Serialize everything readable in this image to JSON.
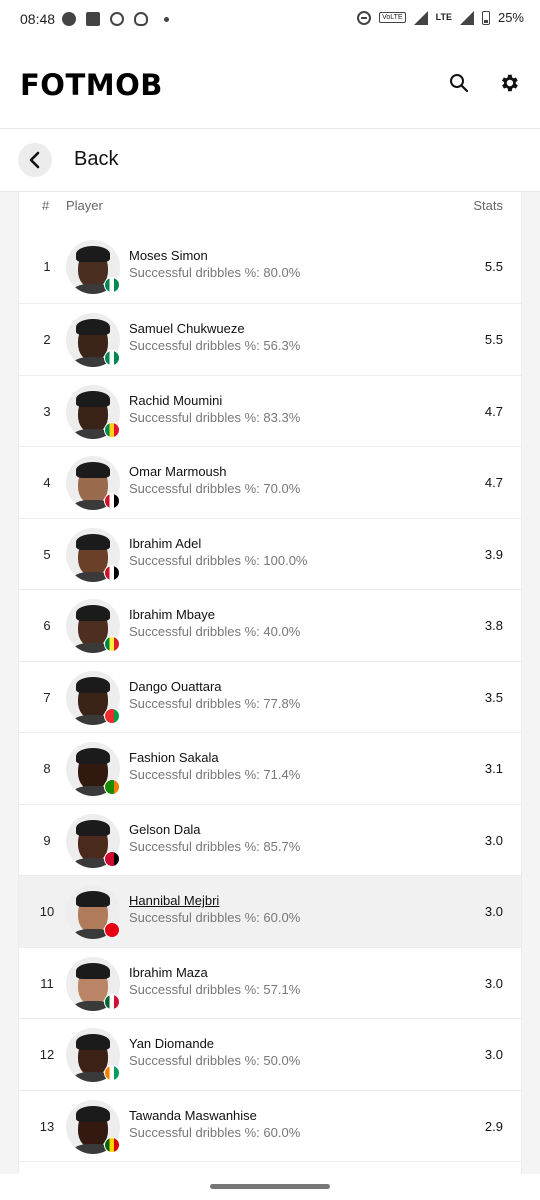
{
  "status_bar": {
    "time": "08:48",
    "battery": "25%",
    "volte": "VoLTE",
    "network": "LTE"
  },
  "app": {
    "logo_text": "FOTMOB"
  },
  "nav": {
    "back_label": "Back"
  },
  "table": {
    "headers": {
      "rank": "#",
      "player": "Player",
      "stats": "Stats"
    },
    "rows": [
      {
        "rank": "1",
        "name": "Moses Simon",
        "detail": "Successful dribbles %: 80.0%",
        "value": "5.5",
        "flag": [
          "#008751",
          "#ffffff",
          "#008751"
        ],
        "skin": "#4a2e1f"
      },
      {
        "rank": "2",
        "name": "Samuel Chukwueze",
        "detail": "Successful dribbles %: 56.3%",
        "value": "5.5",
        "flag": [
          "#008751",
          "#ffffff",
          "#008751"
        ],
        "skin": "#3d2418"
      },
      {
        "rank": "3",
        "name": "Rachid Moumini",
        "detail": "Successful dribbles %: 83.3%",
        "value": "4.7",
        "flag": [
          "#008751",
          "#fcd116",
          "#e8112d"
        ],
        "skin": "#3a2216"
      },
      {
        "rank": "4",
        "name": "Omar Marmoush",
        "detail": "Successful dribbles %: 70.0%",
        "value": "4.7",
        "flag": [
          "#ce1126",
          "#ffffff",
          "#000000"
        ],
        "skin": "#9a6a4c"
      },
      {
        "rank": "5",
        "name": "Ibrahim Adel",
        "detail": "Successful dribbles %: 100.0%",
        "value": "3.9",
        "flag": [
          "#ce1126",
          "#ffffff",
          "#000000"
        ],
        "skin": "#6b4028"
      },
      {
        "rank": "6",
        "name": "Ibrahim Mbaye",
        "detail": "Successful dribbles %: 40.0%",
        "value": "3.8",
        "flag": [
          "#00853f",
          "#fdef42",
          "#e31b23"
        ],
        "skin": "#4e2e1e"
      },
      {
        "rank": "7",
        "name": "Dango Ouattara",
        "detail": "Successful dribbles %: 77.8%",
        "value": "3.5",
        "flag": [
          "#ef2b2d",
          "#ef2b2d",
          "#009e49"
        ],
        "skin": "#3b2216"
      },
      {
        "rank": "8",
        "name": "Fashion Sakala",
        "detail": "Successful dribbles %: 71.4%",
        "value": "3.1",
        "flag": [
          "#198a00",
          "#198a00",
          "#ef7d00"
        ],
        "skin": "#32190f"
      },
      {
        "rank": "9",
        "name": "Gelson Dala",
        "detail": "Successful dribbles %: 85.7%",
        "value": "3.0",
        "flag": [
          "#cc092f",
          "#cc092f",
          "#000000"
        ],
        "skin": "#4a2a1a"
      },
      {
        "rank": "10",
        "name": "Hannibal Mejbri",
        "detail": "Successful dribbles %: 60.0%",
        "value": "3.0",
        "flag": [
          "#e70013",
          "#e70013",
          "#e70013"
        ],
        "skin": "#b07b5a"
      },
      {
        "rank": "11",
        "name": "Ibrahim Maza",
        "detail": "Successful dribbles %: 57.1%",
        "value": "3.0",
        "flag": [
          "#006233",
          "#ffffff",
          "#d21034"
        ],
        "skin": "#b98566"
      },
      {
        "rank": "12",
        "name": "Yan Diomande",
        "detail": "Successful dribbles %: 50.0%",
        "value": "3.0",
        "flag": [
          "#f77f00",
          "#ffffff",
          "#009e60"
        ],
        "skin": "#3c2216"
      },
      {
        "rank": "13",
        "name": "Tawanda Maswanhise",
        "detail": "Successful dribbles %: 60.0%",
        "value": "2.9",
        "flag": [
          "#006400",
          "#ffd200",
          "#d40000"
        ],
        "skin": "#33190f"
      }
    ],
    "highlighted_rank": "10"
  },
  "colors": {
    "accent_bg": "#ffffff",
    "page_bg": "#f4f4f4",
    "highlight_row": "#f1f1f2"
  }
}
